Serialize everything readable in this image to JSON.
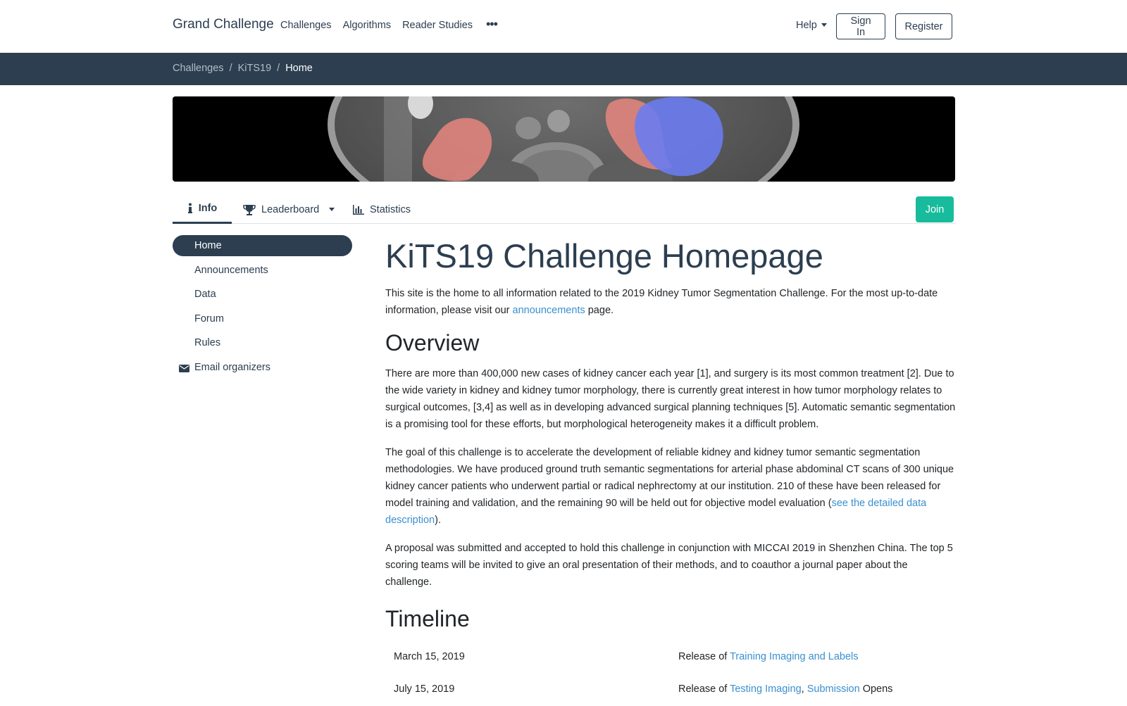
{
  "nav": {
    "brand": "Grand Challenge",
    "links": [
      "Challenges",
      "Algorithms",
      "Reader Studies"
    ],
    "more_icon": "ellipsis-icon",
    "help": "Help",
    "signin": "Sign In",
    "register": "Register"
  },
  "breadcrumb": {
    "items": [
      "Challenges",
      "KiTS19"
    ],
    "current": "Home"
  },
  "tabs": {
    "info": "Info",
    "leaderboard": "Leaderboard",
    "statistics": "Statistics",
    "join": "Join"
  },
  "sidebar": {
    "items": [
      "Home",
      "Announcements",
      "Data",
      "Forum",
      "Rules"
    ],
    "email": "Email organizers"
  },
  "main": {
    "title": "KiTS19 Challenge Homepage",
    "intro_before": "This site is the home to all information related to the 2019 Kidney Tumor Segmentation Challenge. For the most up-to-date information, please visit our ",
    "intro_link": "announcements",
    "intro_after": " page.",
    "overview_heading": "Overview",
    "overview_p1": "There are more than 400,000 new cases of kidney cancer each year [1], and surgery is its most common treatment [2]. Due to the wide variety in kidney and kidney tumor morphology, there is currently great interest in how tumor morphology relates to surgical outcomes, [3,4] as well as in developing advanced surgical planning techniques [5]. Automatic semantic segmentation is a promising tool for these efforts, but morphological heterogeneity makes it a difficult problem.",
    "overview_p2_before": "The goal of this challenge is to accelerate the development of reliable kidney and kidney tumor semantic segmentation methodologies. We have produced ground truth semantic segmentations for arterial phase abdominal CT scans of 300 unique kidney cancer patients who underwent partial or radical nephrectomy at our institution. 210 of these have been released for model training and validation, and the remaining 90 will be held out for objective model evaluation (",
    "overview_p2_link": "see the detailed data description",
    "overview_p2_after": ").",
    "overview_p3": "A proposal was submitted and accepted to hold this challenge in conjunction with MICCAI 2019 in Shenzhen China. The top 5 scoring teams will be invited to give an oral presentation of their methods, and to coauthor a journal paper about the challenge.",
    "timeline_heading": "Timeline",
    "timeline": [
      {
        "date": "March 15, 2019",
        "prefix": "Release of ",
        "link1": "Training Imaging and Labels",
        "mid": "",
        "link2": "",
        "suffix": ""
      },
      {
        "date": "July 15, 2019",
        "prefix": "Release of ",
        "link1": "Testing Imaging",
        "mid": ", ",
        "link2": "Submission",
        "suffix": " Opens"
      }
    ]
  },
  "colors": {
    "primary": "#2c3e50",
    "success": "#18bc9c",
    "link": "#3a8fd0",
    "kidney_overlay": "#e8857f",
    "tumor_overlay": "#6a7cf0"
  }
}
